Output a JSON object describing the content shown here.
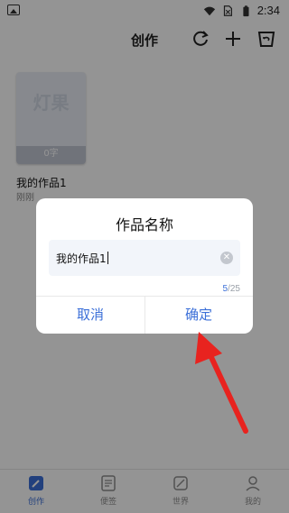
{
  "status_bar": {
    "time": "2:34"
  },
  "header": {
    "title": "创作"
  },
  "work": {
    "cover_watermark": "灯果",
    "words": "0字",
    "title": "我的作品1",
    "time": "刚刚"
  },
  "tabs": [
    {
      "label": "创作",
      "icon": "pen-doc-icon",
      "active": true
    },
    {
      "label": "便签",
      "icon": "note-icon",
      "active": false
    },
    {
      "label": "世界",
      "icon": "compass-icon",
      "active": false
    },
    {
      "label": "我的",
      "icon": "person-icon",
      "active": false
    }
  ],
  "dialog": {
    "title": "作品名称",
    "input_value": "我的作品1",
    "counter_current": "5",
    "counter_max": "/25",
    "cancel_label": "取消",
    "confirm_label": "确定"
  },
  "colors": {
    "accent": "#3b6fd8",
    "arrow": "#e8231f",
    "overlay": "rgba(0,0,0,0.42)"
  }
}
